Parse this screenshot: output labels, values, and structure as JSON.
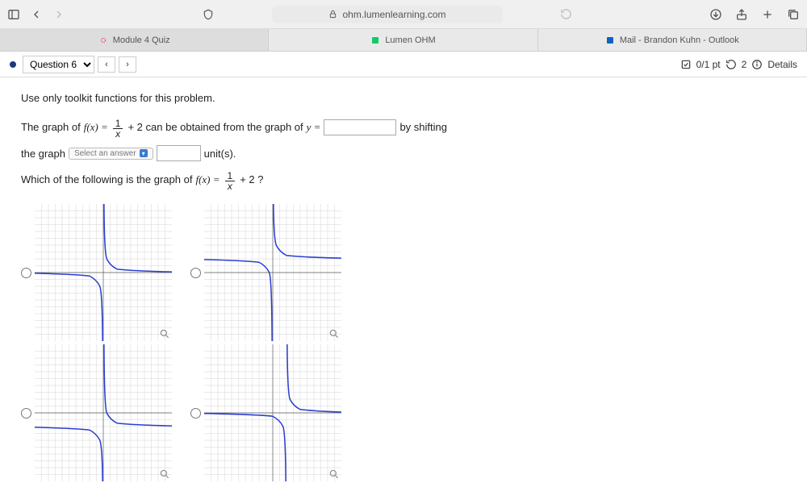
{
  "browser": {
    "url": "ohm.lumenlearning.com"
  },
  "tabs": [
    {
      "label": "Module 4 Quiz",
      "active": true
    },
    {
      "label": "Lumen OHM",
      "active": false
    },
    {
      "label": "Mail - Brandon Kuhn - Outlook",
      "active": false
    }
  ],
  "question": {
    "label": "Question 6",
    "points": "0/1 pt",
    "retries": "2",
    "details": "Details",
    "instruction": "Use only toolkit functions for this problem.",
    "part1_a": "The graph of ",
    "part1_f": "f(x) =",
    "part1_frac_num": "1",
    "part1_frac_den": "x",
    "part1_b": " + 2  can be obtained from the graph of ",
    "part1_y": "y =",
    "part1_c": "by shifting",
    "part2_a": "the graph",
    "select_placeholder": "Select an answer",
    "part2_b": "unit(s).",
    "part3": "Which of the following is the graph of ",
    "part3_f": "f(x) =",
    "part3_frac_num": "1",
    "part3_frac_den": "x",
    "part3_b": " + 2 ?"
  }
}
